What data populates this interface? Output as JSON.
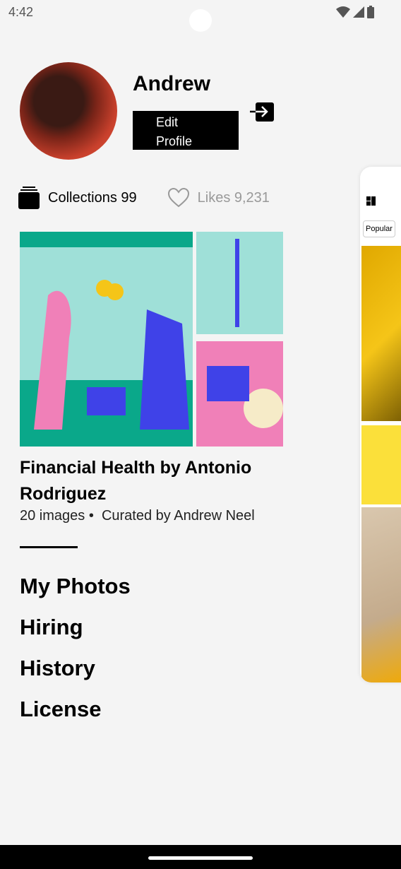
{
  "status": {
    "time": "4:42"
  },
  "profile": {
    "name": "Andrew",
    "edit_label": "Edit Profile",
    "edit_line1": "Edit",
    "edit_line2": "Profile"
  },
  "stats": {
    "collections": "Collections 99",
    "likes": "Likes 9,231"
  },
  "collection": {
    "title": "Financial Health by Antonio Rodriguez",
    "images": "20 images",
    "curator": "Curated by Andrew Neel"
  },
  "menu": [
    "My Photos",
    "Hiring",
    "History",
    "License"
  ],
  "side_panel": {
    "tab": "Popular"
  },
  "colors": {
    "teal": "#0aa88a",
    "blue": "#3f42e8",
    "pink": "#f080b8",
    "yellow": "#f5c518"
  }
}
